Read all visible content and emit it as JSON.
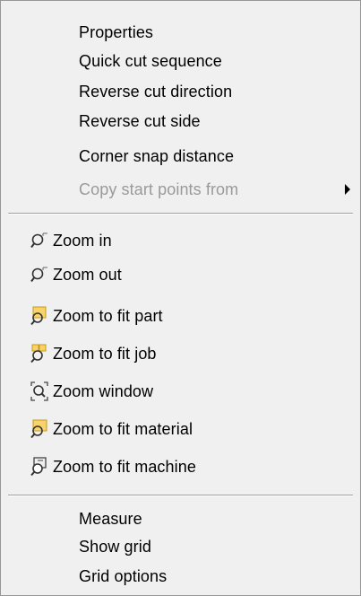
{
  "menu": {
    "section1": [
      {
        "label": "Properties",
        "enabled": true
      },
      {
        "label": "Quick cut sequence",
        "enabled": true
      },
      {
        "label": "Reverse cut direction",
        "enabled": true
      },
      {
        "label": "Reverse cut side",
        "enabled": true
      },
      {
        "label": "Corner snap distance",
        "enabled": true
      },
      {
        "label": "Copy start points from",
        "enabled": false,
        "has_submenu": true
      }
    ],
    "section2": [
      {
        "label": "Zoom in",
        "icon": "zoom-in-icon"
      },
      {
        "label": "Zoom out",
        "icon": "zoom-out-icon"
      },
      {
        "label": "Zoom to fit part",
        "icon": "zoom-fit-part-icon"
      },
      {
        "label": "Zoom to fit job",
        "icon": "zoom-fit-job-icon"
      },
      {
        "label": "Zoom window",
        "icon": "zoom-window-icon"
      },
      {
        "label": "Zoom to fit material",
        "icon": "zoom-fit-material-icon"
      },
      {
        "label": "Zoom to fit machine",
        "icon": "zoom-fit-machine-icon"
      }
    ],
    "section3": [
      {
        "label": "Measure"
      },
      {
        "label": "Show grid"
      },
      {
        "label": "Grid options"
      }
    ]
  },
  "colors": {
    "menu_background": "#f0f0f0",
    "disabled_text": "#9a9a9a",
    "icon_highlight": "#f7d36b"
  }
}
